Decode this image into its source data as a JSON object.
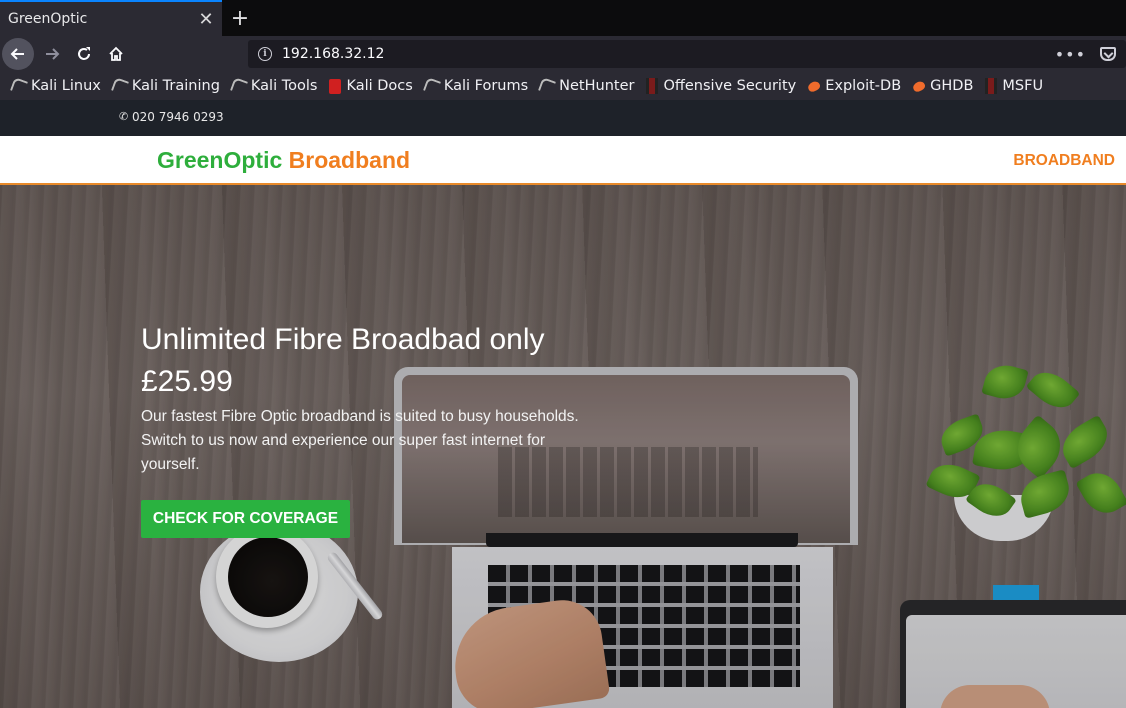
{
  "browser": {
    "tab_title": "GreenOptic",
    "url": "192.168.32.12",
    "bookmarks": [
      {
        "label": "Kali Linux",
        "icon": "kali-dragon-icon"
      },
      {
        "label": "Kali Training",
        "icon": "kali-dragon-icon"
      },
      {
        "label": "Kali Tools",
        "icon": "kali-dragon-icon"
      },
      {
        "label": "Kali Docs",
        "icon": "kali-docs-icon"
      },
      {
        "label": "Kali Forums",
        "icon": "kali-dragon-icon"
      },
      {
        "label": "NetHunter",
        "icon": "kali-dragon-icon"
      },
      {
        "label": "Offensive Security",
        "icon": "offsec-icon"
      },
      {
        "label": "Exploit-DB",
        "icon": "exploitdb-bug-icon"
      },
      {
        "label": "GHDB",
        "icon": "exploitdb-bug-icon"
      },
      {
        "label": "MSFU",
        "icon": "offsec-icon"
      }
    ]
  },
  "site": {
    "phone": "020 7946 0293",
    "brand_green": "GreenOptic",
    "brand_orange": "Broadband",
    "nav_link": "BROADBAND",
    "hero": {
      "title": "Unlimited Fibre Broadbad only £25.99",
      "text": "Our fastest Fibre Optic broadband is suited to busy households. Switch to us now and experience our super fast internet for yourself.",
      "cta": "CHECK FOR COVERAGE"
    },
    "colors": {
      "brand_green": "#2eae3c",
      "brand_orange": "#f07e1f",
      "cta_green": "#2ab240"
    }
  }
}
